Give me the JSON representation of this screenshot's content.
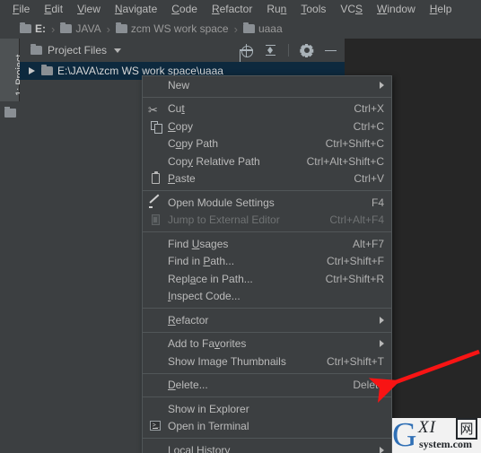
{
  "menubar": {
    "items": [
      {
        "label": "File",
        "mnemonic": "F"
      },
      {
        "label": "Edit",
        "mnemonic": "E"
      },
      {
        "label": "View",
        "mnemonic": "V"
      },
      {
        "label": "Navigate",
        "mnemonic": "N"
      },
      {
        "label": "Code",
        "mnemonic": "C"
      },
      {
        "label": "Refactor",
        "mnemonic": "R"
      },
      {
        "label": "Run",
        "mnemonic": "n"
      },
      {
        "label": "Tools",
        "mnemonic": "T"
      },
      {
        "label": "VCS",
        "mnemonic": "S"
      },
      {
        "label": "Window",
        "mnemonic": "W"
      },
      {
        "label": "Help",
        "mnemonic": "H"
      }
    ]
  },
  "breadcrumb": {
    "separator": "›",
    "items": [
      {
        "label": "E:",
        "icon": "folder-icon"
      },
      {
        "label": "JAVA",
        "icon": "folder-icon"
      },
      {
        "label": "zcm WS work space",
        "icon": "folder-icon"
      },
      {
        "label": "uaaa",
        "icon": "folder-icon"
      }
    ]
  },
  "toolstrip": {
    "project_tab_label": "1: Project",
    "folder_icon": "folder-icon"
  },
  "panel": {
    "title": "Project Files",
    "caret_icon": "chevron-down-icon",
    "actions": [
      {
        "name": "locate-icon"
      },
      {
        "name": "collapse-all-icon"
      },
      {
        "name": "settings-gear-icon"
      },
      {
        "name": "minimize-icon"
      }
    ],
    "tree": {
      "rows": [
        {
          "label": "E:\\JAVA\\zcm WS work space\\uaaa",
          "selected": true,
          "expand_icon": "triangle-right-icon",
          "folder_icon": "folder-icon"
        }
      ]
    }
  },
  "context_menu": {
    "items": [
      {
        "label": "New",
        "mnemonic": "",
        "accel": "",
        "icon": "",
        "submenu": true,
        "disabled": false,
        "divider_after": true
      },
      {
        "label": "Cut",
        "mnemonic": "t",
        "accel": "Ctrl+X",
        "icon": "scissors-icon",
        "submenu": false,
        "disabled": false,
        "divider_after": false
      },
      {
        "label": "Copy",
        "mnemonic": "C",
        "accel": "Ctrl+C",
        "icon": "copy-icon",
        "submenu": false,
        "disabled": false,
        "divider_after": false
      },
      {
        "label": "Copy Path",
        "mnemonic": "o",
        "accel": "Ctrl+Shift+C",
        "icon": "",
        "submenu": false,
        "disabled": false,
        "divider_after": false
      },
      {
        "label": "Copy Relative Path",
        "mnemonic": "y",
        "accel": "Ctrl+Alt+Shift+C",
        "icon": "",
        "submenu": false,
        "disabled": false,
        "divider_after": false
      },
      {
        "label": "Paste",
        "mnemonic": "P",
        "accel": "Ctrl+V",
        "icon": "paste-icon",
        "submenu": false,
        "disabled": false,
        "divider_after": true
      },
      {
        "label": "Open Module Settings",
        "mnemonic": "",
        "accel": "F4",
        "icon": "pencil-icon",
        "submenu": false,
        "disabled": false,
        "divider_after": false
      },
      {
        "label": "Jump to External Editor",
        "mnemonic": "",
        "accel": "Ctrl+Alt+F4",
        "icon": "external-editor-icon",
        "submenu": false,
        "disabled": true,
        "divider_after": true
      },
      {
        "label": "Find Usages",
        "mnemonic": "U",
        "accel": "Alt+F7",
        "icon": "",
        "submenu": false,
        "disabled": false,
        "divider_after": false
      },
      {
        "label": "Find in Path...",
        "mnemonic": "P",
        "accel": "Ctrl+Shift+F",
        "icon": "",
        "submenu": false,
        "disabled": false,
        "divider_after": false
      },
      {
        "label": "Replace in Path...",
        "mnemonic": "a",
        "accel": "Ctrl+Shift+R",
        "icon": "",
        "submenu": false,
        "disabled": false,
        "divider_after": false
      },
      {
        "label": "Inspect Code...",
        "mnemonic": "I",
        "accel": "",
        "icon": "",
        "submenu": false,
        "disabled": false,
        "divider_after": true
      },
      {
        "label": "Refactor",
        "mnemonic": "R",
        "accel": "",
        "icon": "",
        "submenu": true,
        "disabled": false,
        "divider_after": true
      },
      {
        "label": "Add to Favorites",
        "mnemonic": "v",
        "accel": "",
        "icon": "",
        "submenu": true,
        "disabled": false,
        "divider_after": false
      },
      {
        "label": "Show Image Thumbnails",
        "mnemonic": "",
        "accel": "Ctrl+Shift+T",
        "icon": "",
        "submenu": false,
        "disabled": false,
        "divider_after": true
      },
      {
        "label": "Delete...",
        "mnemonic": "D",
        "accel": "Delete",
        "icon": "",
        "submenu": false,
        "disabled": false,
        "divider_after": true
      },
      {
        "label": "Show in Explorer",
        "mnemonic": "",
        "accel": "",
        "icon": "",
        "submenu": false,
        "disabled": false,
        "divider_after": false
      },
      {
        "label": "Open in Terminal",
        "mnemonic": "",
        "accel": "",
        "icon": "terminal-icon",
        "submenu": false,
        "disabled": false,
        "divider_after": true
      },
      {
        "label": "Local History",
        "mnemonic": "H",
        "accel": "",
        "icon": "",
        "submenu": true,
        "disabled": false,
        "divider_after": false
      }
    ]
  },
  "annotation": {
    "arrow_color": "#f81414",
    "points_at": "Delete..."
  },
  "watermark": {
    "letter": "G",
    "xi": "XI",
    "cn": "网",
    "site": "system.com",
    "brand_color": "#2f6fb5"
  }
}
